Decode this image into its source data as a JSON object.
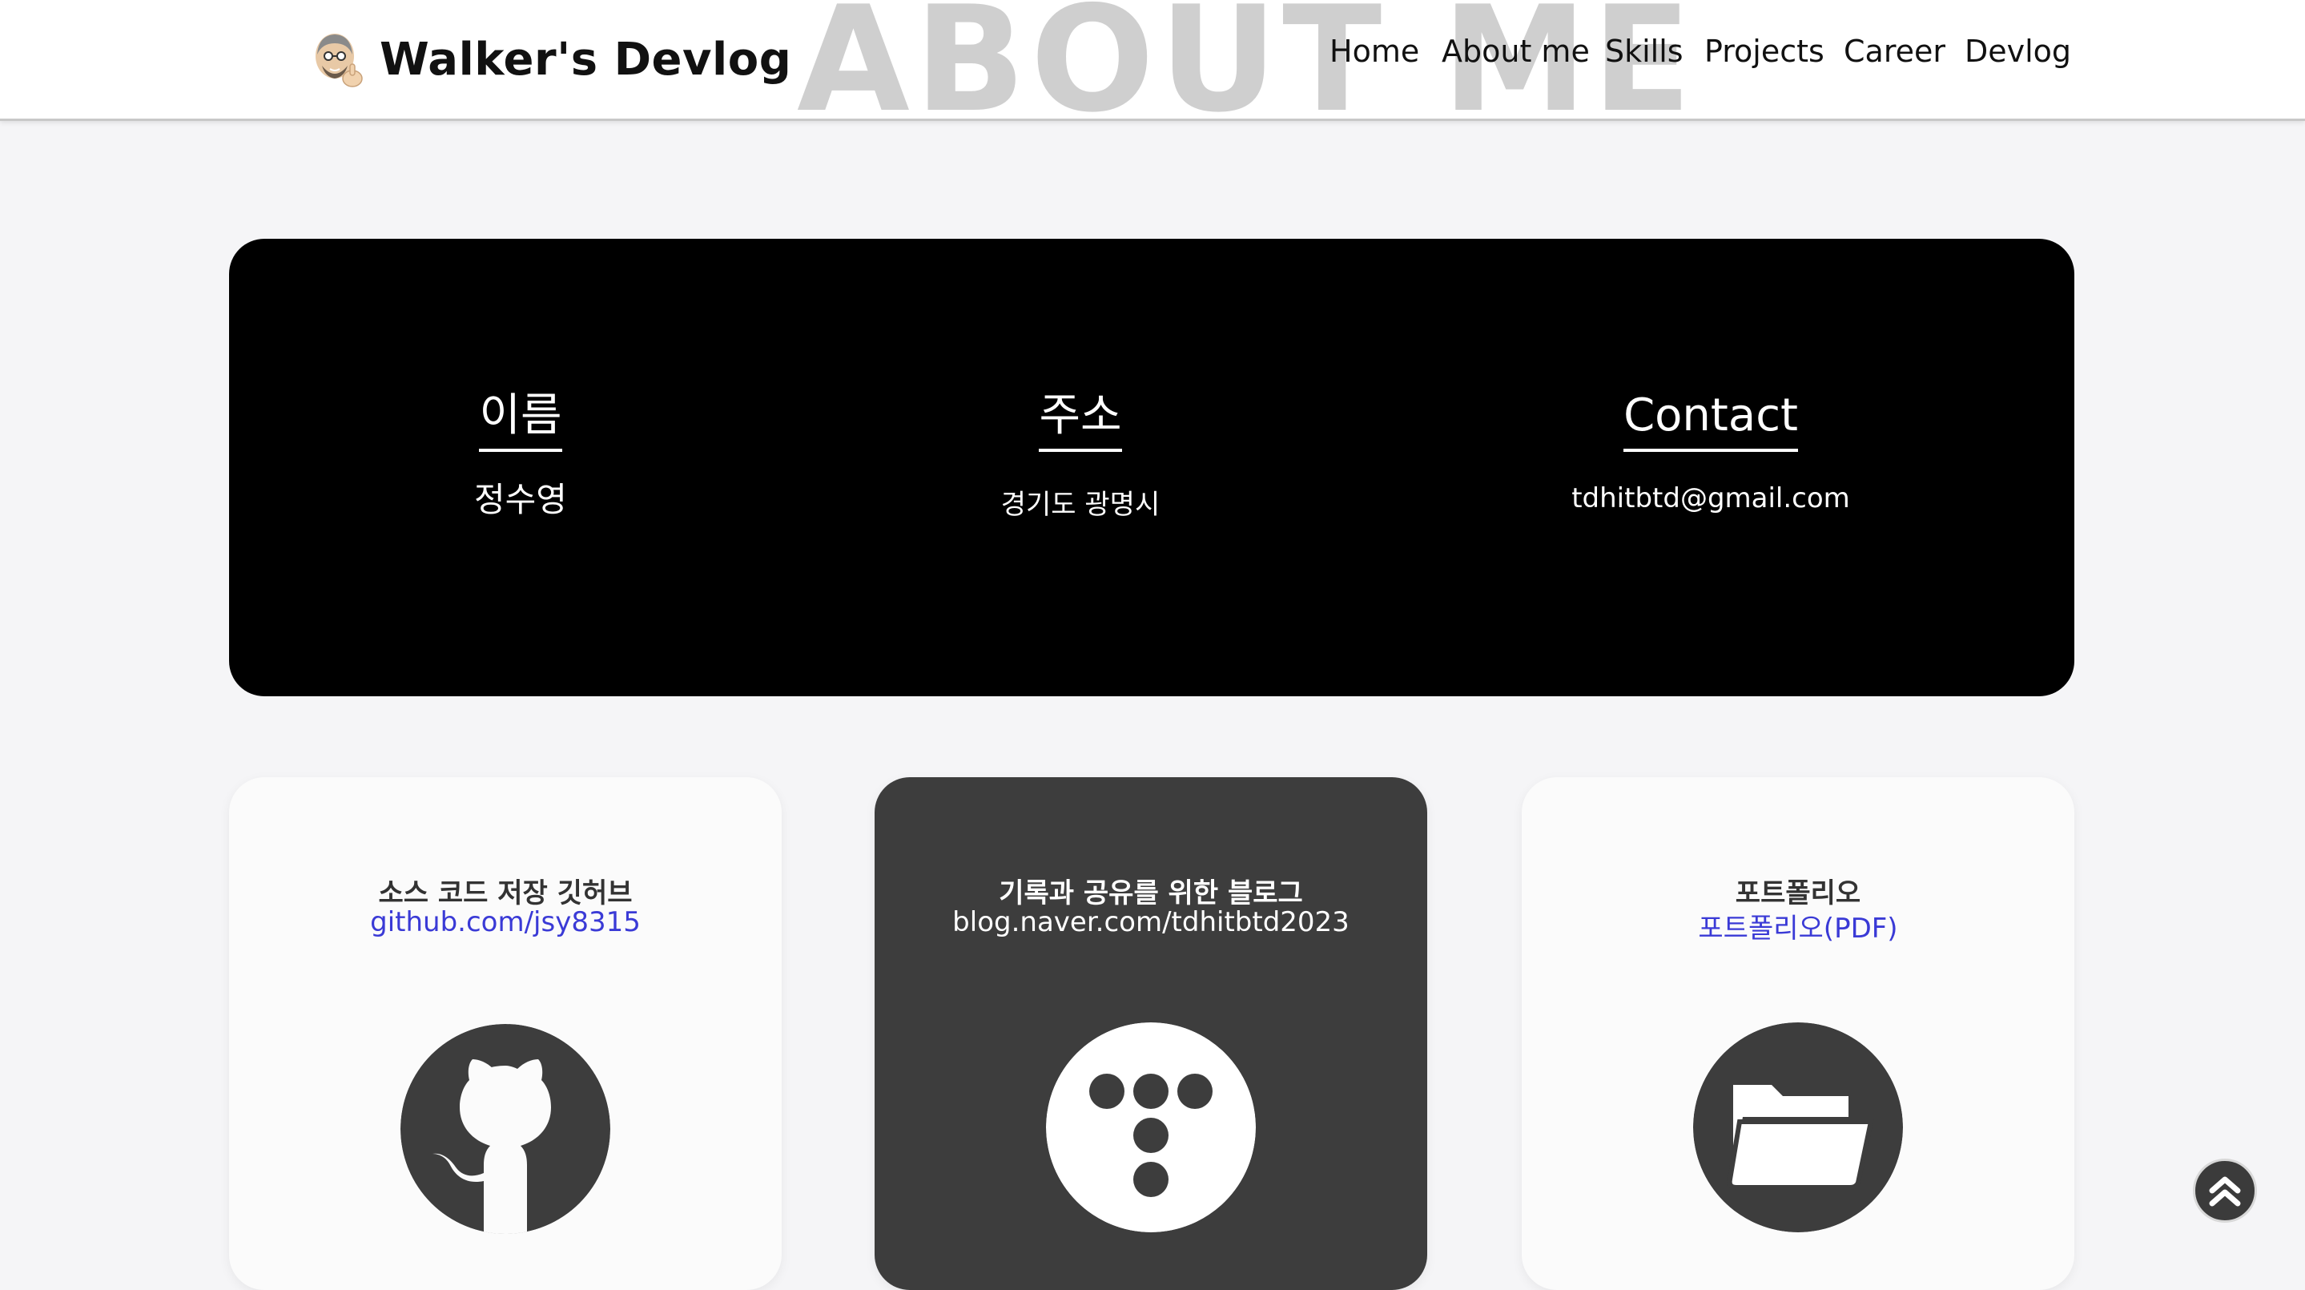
{
  "header": {
    "brand_name": "Walker's Devlog",
    "avatar_icon": "memoji-thumbs-up-icon",
    "bg_title": "ABOUT ME",
    "nav": [
      {
        "label": "Home"
      },
      {
        "label": "About me"
      },
      {
        "label": "Skills"
      },
      {
        "label": "Projects"
      },
      {
        "label": "Career"
      },
      {
        "label": "Devlog"
      }
    ]
  },
  "info": {
    "name": {
      "heading": "이름",
      "value": "정수영"
    },
    "address": {
      "heading": "주소",
      "value": "경기도 광명시"
    },
    "contact": {
      "heading": "Contact",
      "value": "tdhitbtd@gmail.com"
    }
  },
  "cards": [
    {
      "title": "소스 코드 저장 깃허브",
      "link": "github.com/jsy8315",
      "icon": "github-icon"
    },
    {
      "title": "기록과 공유를 위한 블로그",
      "link": "blog.naver.com/tdhitbtd2023",
      "icon": "tistory-icon"
    },
    {
      "title": "포트폴리오",
      "link": "포트폴리오(PDF)",
      "icon": "folder-icon"
    }
  ],
  "colors": {
    "page_bg": "#f5f5f7",
    "panel_bg": "#000000",
    "dark_card_bg": "#3d3d3d",
    "link_blue": "#3a3ad6",
    "icon_dark": "#3d3d3d"
  },
  "scroll_top_icon": "double-chevron-up-icon"
}
